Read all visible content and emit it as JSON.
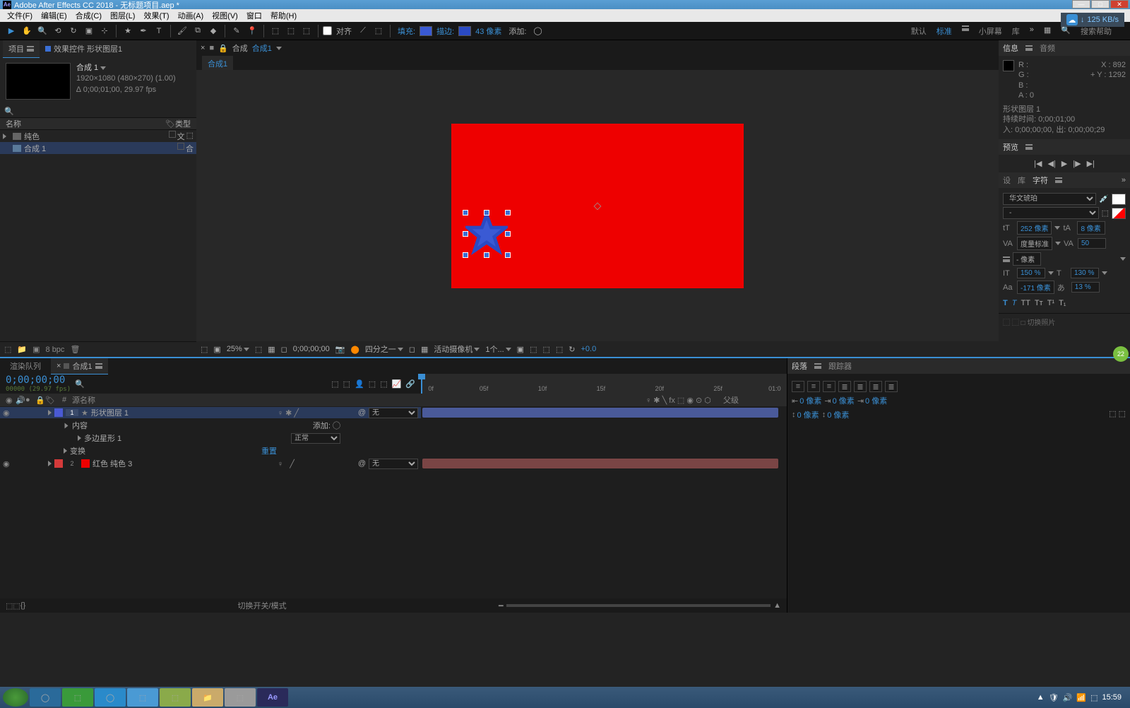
{
  "title": "Adobe After Effects CC 2018 - 无标题项目.aep *",
  "menu": [
    "文件(F)",
    "编辑(E)",
    "合成(C)",
    "图层(L)",
    "效果(T)",
    "动画(A)",
    "视图(V)",
    "窗口",
    "帮助(H)"
  ],
  "net_speed": "125 KB/s",
  "toolbar": {
    "snap": "对齐",
    "fill": "填充:",
    "stroke": "描边:",
    "stroke_px": "43 像素",
    "add": "添加:"
  },
  "workspaces": {
    "default": "默认",
    "standard": "标准",
    "small": "小屏幕",
    "lib": "库"
  },
  "search_placeholder": "搜索帮助",
  "project": {
    "tab_project": "项目",
    "tab_fx": "效果控件 形状图层1",
    "comp_name": "合成 1",
    "comp_res": "1920×1080 (480×270) (1.00)",
    "comp_dur": "∆ 0;00;01;00, 29.97 fps",
    "col_name": "名称",
    "col_type": "类型",
    "item_solids": "纯色",
    "item_comp": "合成 1",
    "bpc": "8 bpc"
  },
  "viewer": {
    "comp_label": "合成",
    "comp_name": "合成1",
    "tab": "合成1",
    "zoom": "25%",
    "time": "0;00;00;00",
    "res": "四分之一",
    "camera": "活动摄像机",
    "views": "1个...",
    "exposure": "+0.0"
  },
  "info": {
    "tab_info": "信息",
    "tab_audio": "音频",
    "r": "R :",
    "g": "G :",
    "b": "B :",
    "a": "A : 0",
    "x": "X : 892",
    "y": "Y : 1292",
    "layer": "形状图层 1",
    "duration": "持续时间: 0;00;01;00",
    "inout": "入: 0;00;00;00, 出: 0;00;00;29"
  },
  "preview": {
    "tab": "预览"
  },
  "char": {
    "tabs": {
      "design": "设",
      "lib": "库",
      "char": "字符"
    },
    "font": "华文琥珀",
    "style": "-",
    "size": "252 像素",
    "leading": "8 像素",
    "kerning_label": "度量标准",
    "tracking": "50",
    "units": "- 像素",
    "vscale": "150 %",
    "hscale": "130 %",
    "baseline": "-171 像素",
    "tsume": "13 %"
  },
  "paragraph": {
    "tab_para": "段落",
    "tab_track": "跟踪器",
    "indent": "0 像素"
  },
  "timeline": {
    "tab_render": "渲染队列",
    "tab_comp": "合成1",
    "timecode": "0;00;00;00",
    "timecode_sub": "00000 (29.97 fps)",
    "col_source": "源名称",
    "col_parent": "父级",
    "ruler": [
      "0f",
      "05f",
      "10f",
      "15f",
      "20f",
      "25f",
      "01:0"
    ],
    "layer1": {
      "idx": "1",
      "name": "形状图层 1",
      "parent": "无"
    },
    "layer1_contents": "内容",
    "layer1_add": "添加:",
    "layer1_poly": "多边星形 1",
    "layer1_poly_mode": "正常",
    "layer1_transform": "变换",
    "layer1_reset": "重置",
    "layer2": {
      "idx": "2",
      "name": "红色 纯色 3",
      "parent": "无"
    },
    "footer": "切换开关/模式"
  },
  "taskbar": {
    "time": "15:59"
  }
}
